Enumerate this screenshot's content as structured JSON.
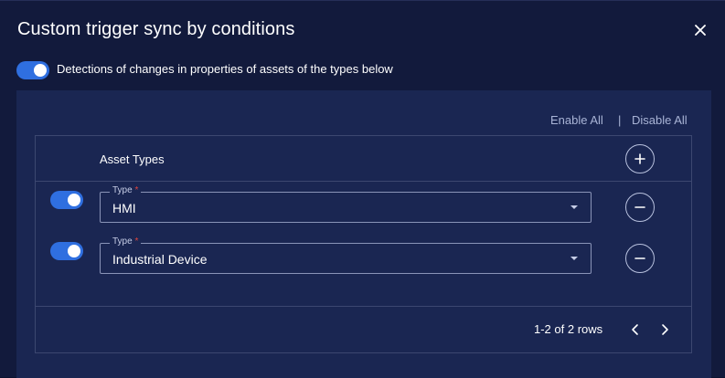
{
  "dialog": {
    "title": "Custom trigger sync by conditions",
    "detection_label": "Detections of changes in properties of assets of the types below",
    "detection_enabled": true
  },
  "actions": {
    "enable_all": "Enable All",
    "separator": "|",
    "disable_all": "Disable All"
  },
  "table": {
    "column_title": "Asset Types",
    "field_label": "Type",
    "required_marker": "*",
    "rows": [
      {
        "enabled": true,
        "value": "HMI"
      },
      {
        "enabled": true,
        "value": "Industrial Device"
      }
    ],
    "pagination": "1-2 of 2 rows"
  },
  "colors": {
    "background": "#121a3c",
    "panel": "#1a2652",
    "accent": "#2f6fe0",
    "required": "#e0463c"
  },
  "icons": {
    "close": "close-icon",
    "add": "plus-icon",
    "remove": "minus-icon",
    "dropdown": "chevron-down-icon",
    "prev": "chevron-left-icon",
    "next": "chevron-right-icon"
  }
}
